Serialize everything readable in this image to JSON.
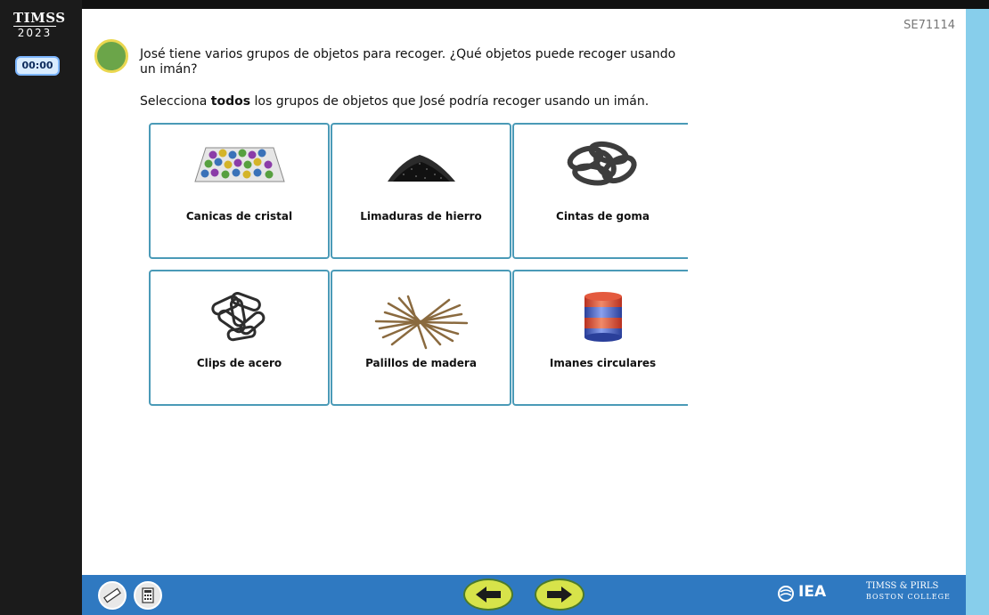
{
  "header": {
    "logo_top": "TIMSS",
    "logo_year": "2023",
    "timer": "00:00",
    "item_code": "SE71114"
  },
  "question": {
    "text": "José tiene varios grupos de objetos para recoger. ¿Qué objetos puede recoger usando un imán?",
    "instruction_pre": "Selecciona ",
    "instruction_bold": "todos",
    "instruction_post": " los grupos de objetos que José podría recoger usando un imán."
  },
  "options": [
    {
      "label": "Canicas de cristal",
      "icon": "marbles-icon"
    },
    {
      "label": "Limaduras de hierro",
      "icon": "iron-filings-icon"
    },
    {
      "label": "Cintas de goma",
      "icon": "rubber-bands-icon"
    },
    {
      "label": "Clips de acero",
      "icon": "paperclips-icon"
    },
    {
      "label": "Palillos de madera",
      "icon": "toothpicks-icon"
    },
    {
      "label": "Imanes circulares",
      "icon": "circular-magnets-icon"
    }
  ],
  "footer": {
    "iea_label": "IEA",
    "brand_top": "TIMSS & PIRLS",
    "brand_bottom": "BOSTON COLLEGE"
  },
  "colors": {
    "accent_border": "#4a9ab7",
    "bottom_bar": "#2f79c1",
    "right_bar": "#87ceeb",
    "status_dot": "#6ba549"
  }
}
